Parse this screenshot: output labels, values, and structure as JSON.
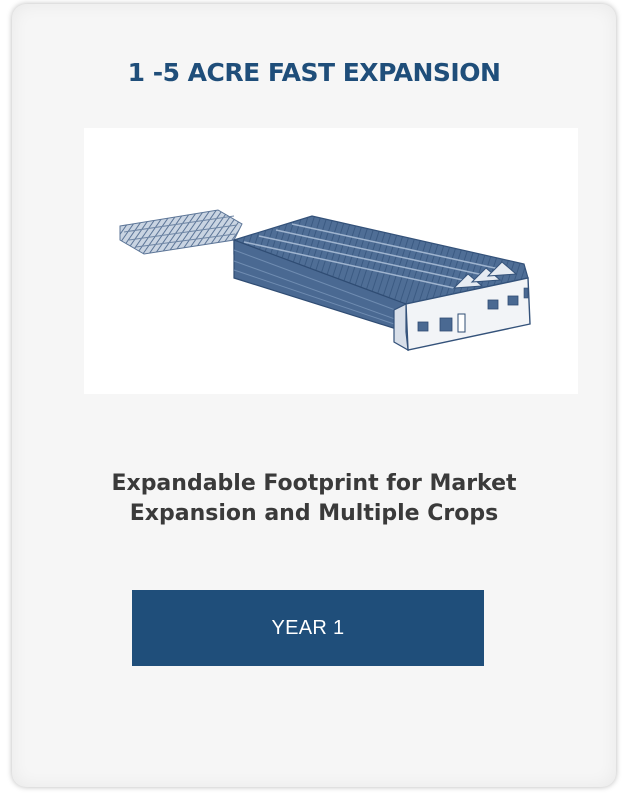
{
  "card": {
    "title": "1 -5 ACRE FAST EXPANSION",
    "illustration_icon": "greenhouse-building-illustration",
    "description_line1": "Expandable Footprint for Market",
    "description_line2": "Expansion and Multiple Crops",
    "button_label": "YEAR 1"
  },
  "colors": {
    "accent": "#1f4e7a",
    "card_background": "#f6f6f6",
    "description_text": "#3a3a3a",
    "button_text": "#ffffff"
  }
}
